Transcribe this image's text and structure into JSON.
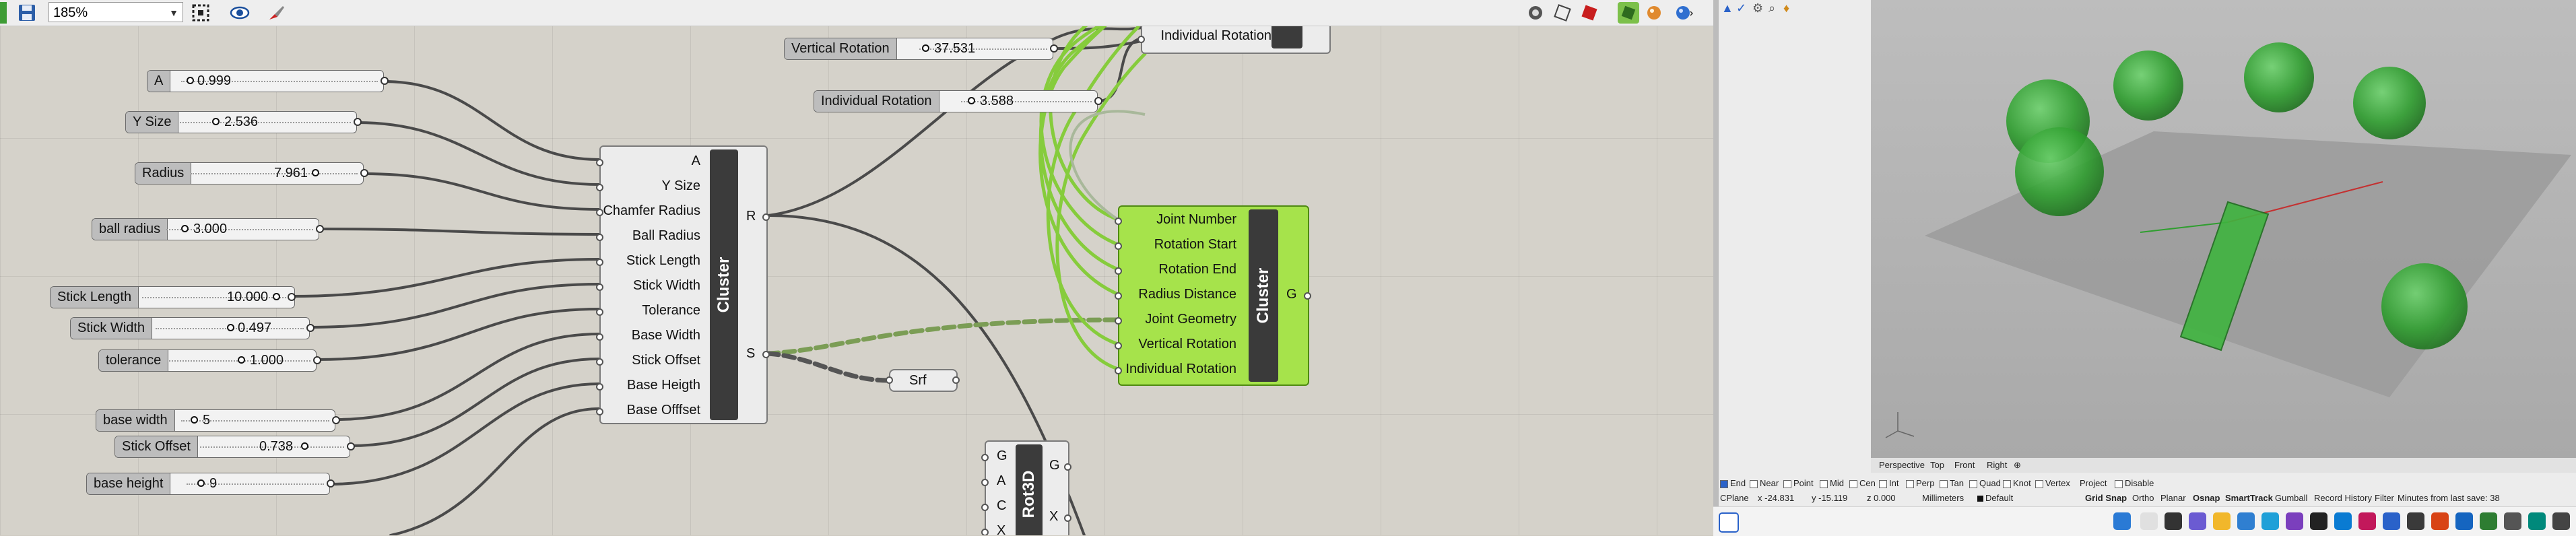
{
  "toolbar": {
    "zoom": "185%"
  },
  "sliders": [
    {
      "id": "a",
      "label": "A",
      "value": "0.999"
    },
    {
      "id": "ysize",
      "label": "Y Size",
      "value": "2.536"
    },
    {
      "id": "radius",
      "label": "Radius",
      "value": "7.961"
    },
    {
      "id": "ballradius",
      "label": "ball radius",
      "value": "3.000"
    },
    {
      "id": "sticklength",
      "label": "Stick Length",
      "value": "10.000"
    },
    {
      "id": "stickwidth",
      "label": "Stick Width",
      "value": "0.497"
    },
    {
      "id": "tolerance",
      "label": "tolerance",
      "value": "1.000"
    },
    {
      "id": "basewidth",
      "label": "base width",
      "value": "5"
    },
    {
      "id": "stickoffset",
      "label": "Stick Offset",
      "value": "0.738"
    },
    {
      "id": "baseheight",
      "label": "base height",
      "value": "9"
    },
    {
      "id": "vrot",
      "label": "Vertical Rotation",
      "value": "37.531"
    },
    {
      "id": "irot",
      "label": "Individual Rotation",
      "value": "3.588"
    }
  ],
  "cluster1": {
    "title": "Cluster",
    "inputs": [
      "A",
      "Y Size",
      "Chamfer Radius",
      "Ball Radius",
      "Stick Length",
      "Stick Width",
      "Tolerance",
      "Base Width",
      "Stick Offset",
      "Base Heigth",
      "Base Offfset"
    ],
    "outputs": [
      "R",
      "S"
    ]
  },
  "cluster2": {
    "title": "Cluster",
    "inputs": [
      "Joint Number",
      "Rotation Start",
      "Rotation End",
      "Radius Distance",
      "Joint Geometry",
      "Vertical Rotation",
      "Individual Rotation"
    ],
    "outputs": [
      "G"
    ]
  },
  "top_comp": {
    "input": "Individual Rotation"
  },
  "srf": {
    "label": "Srf"
  },
  "rot3d": {
    "title": "Rot3D",
    "inputs": [
      "G",
      "A",
      "C",
      "X"
    ],
    "outputs": [
      "G",
      "X"
    ]
  },
  "viewport_tabs": [
    "Perspective",
    "Top",
    "Front",
    "Right"
  ],
  "osnap": {
    "items": [
      {
        "label": "End",
        "on": true
      },
      {
        "label": "Near",
        "on": false
      },
      {
        "label": "Point",
        "on": false
      },
      {
        "label": "Mid",
        "on": false
      },
      {
        "label": "Cen",
        "on": false
      },
      {
        "label": "Int",
        "on": false
      },
      {
        "label": "Perp",
        "on": false
      },
      {
        "label": "Tan",
        "on": false
      },
      {
        "label": "Quad",
        "on": false
      },
      {
        "label": "Knot",
        "on": false
      },
      {
        "label": "Vertex",
        "on": false
      }
    ],
    "project": "Project",
    "disable": "Disable"
  },
  "status": {
    "cplane": "CPlane",
    "x": "x -24.831",
    "y": "y -15.119",
    "z": "z 0.000",
    "units": "Millimeters",
    "layer": "Default",
    "grid_snap": "Grid Snap",
    "ortho": "Ortho",
    "planar": "Planar",
    "osnap": "Osnap",
    "smarttrack": "SmartTrack",
    "gumball": "Gumball",
    "record": "Record History",
    "filter": "Filter",
    "minutes": "Minutes from last save: 38"
  },
  "colors": {
    "cluster_green": "#a6e34b",
    "sphere_green": "#2f9e2f",
    "canvas": "#d5d2ca"
  }
}
